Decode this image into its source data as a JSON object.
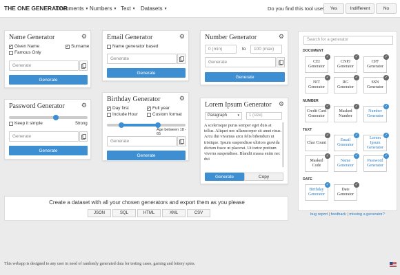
{
  "app": {
    "brand": "THE ONE GENERATOR"
  },
  "nav": [
    {
      "label": "Documents"
    },
    {
      "label": "Numbers"
    },
    {
      "label": "Text"
    },
    {
      "label": "Datasets"
    }
  ],
  "feedback": {
    "question": "Do you find this tool useful?",
    "yes": "Yes",
    "indifferent": "Indifferent",
    "no": "No"
  },
  "name_gen": {
    "title": "Name Generator",
    "given": "Given Name",
    "surname": "Surname",
    "famous": "Famous Only",
    "placeholder": "Generate",
    "button": "Generate"
  },
  "password_gen": {
    "title": "Password Generator",
    "keep_simple": "Keep it simple",
    "strong": "Strong",
    "placeholder": "Generate",
    "button": "Generate",
    "strength_level": 0.6
  },
  "email_gen": {
    "title": "Email Generator",
    "name_based": "Name generator based",
    "placeholder": "Generate",
    "button": "Generate"
  },
  "birthday_gen": {
    "title": "Birthday Generator",
    "day_first": "Day first",
    "full_year": "Full year",
    "include_hour": "Include Hour",
    "custom_format": "Custom format",
    "age_label": "Age between 18 - 65",
    "age_min": 18,
    "age_max": 65,
    "placeholder": "Generate",
    "button": "Generate"
  },
  "number_gen": {
    "title": "Number Generator",
    "min_placeholder": "0 (min)",
    "to": "to",
    "max_placeholder": "100 (max)",
    "placeholder": "Generate",
    "button": "Generate"
  },
  "lorem_gen": {
    "title": "Lorem Ipsum Generator",
    "type": "Paragraph",
    "size_placeholder": "1 (size)",
    "text": "A scelerisque purus semper eget duis at tellus. Aliquet nec ullamcorper sit amet risus. Arcu dui vivamus arcu felis bibendum ut tristique. Ipsum suspendisse ultrices gravida dictum fusce ut placerat. Ut tortor pretium viverra suspendisse. Blandit massa enim nec dui",
    "generate": "Generate",
    "copy": "Copy"
  },
  "export": {
    "title": "Create a dataset with all your chosen generators and export them as you please",
    "formats": [
      "JSON",
      "SQL",
      "HTML",
      "XML",
      "CSV"
    ]
  },
  "sidebar": {
    "search_placeholder": "Search for a generator",
    "sections": [
      {
        "label": "DOCUMENT",
        "items": [
          {
            "label": "CEI Generator",
            "selected": false
          },
          {
            "label": "CNPJ Generator",
            "selected": false
          },
          {
            "label": "CPF Generator",
            "selected": false
          },
          {
            "label": "NIT Generator",
            "selected": false
          },
          {
            "label": "RG Generator",
            "selected": false
          },
          {
            "label": "SSN Generator",
            "selected": false
          }
        ]
      },
      {
        "label": "NUMBER",
        "items": [
          {
            "label": "Credit Card Generator",
            "selected": false
          },
          {
            "label": "Masked Number",
            "selected": false
          },
          {
            "label": "Number Generator",
            "selected": true
          }
        ]
      },
      {
        "label": "TEXT",
        "items": [
          {
            "label": "Char Count",
            "selected": false
          },
          {
            "label": "Email Generator",
            "selected": true
          },
          {
            "label": "Lorem Ipsum Generator",
            "selected": true
          },
          {
            "label": "Masked Code",
            "selected": false
          },
          {
            "label": "Name Generator",
            "selected": true
          },
          {
            "label": "Password Generator",
            "selected": true
          }
        ]
      },
      {
        "label": "DATE",
        "items": [
          {
            "label": "Birthday Generator",
            "selected": true
          },
          {
            "label": "Date Generator",
            "selected": false
          }
        ]
      }
    ]
  },
  "links": {
    "bug": "bug report",
    "sep": "|",
    "feedback": "feedback",
    "missing": "missing a generator?"
  },
  "footer": "This webapp is designed to any user in need of randomly generated data for testing cases, gaming and lottery spins.",
  "colors": {
    "accent": "#3d8fd1"
  }
}
